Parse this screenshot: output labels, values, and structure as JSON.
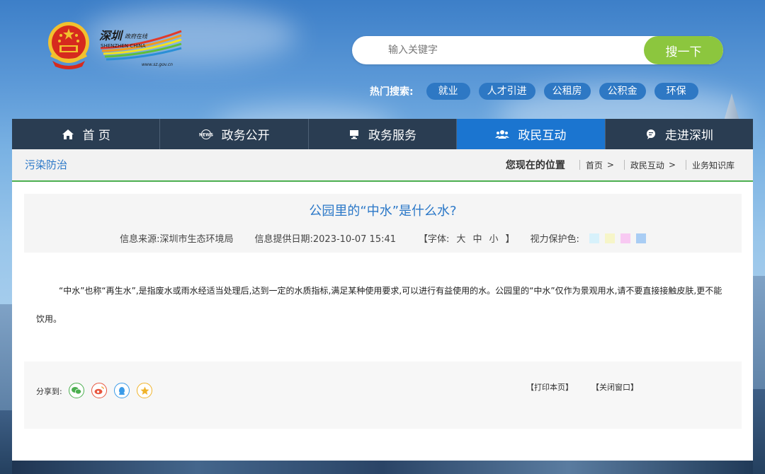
{
  "header": {
    "logo_text": "深圳政府在线",
    "logo_sub": "SHENZHEN CHINA",
    "logo_url": "www.sz.gov.cn"
  },
  "search": {
    "placeholder": "输入关键字",
    "button_label": "搜一下"
  },
  "hot_search": {
    "label": "热门搜索:",
    "tags": [
      "就业",
      "人才引进",
      "公租房",
      "公积金",
      "环保"
    ]
  },
  "nav": {
    "items": [
      {
        "label": "首 页",
        "icon": "home-icon"
      },
      {
        "label": "政务公开",
        "icon": "news-icon"
      },
      {
        "label": "政务服务",
        "icon": "monitor-icon"
      },
      {
        "label": "政民互动",
        "icon": "users-icon",
        "active": true
      },
      {
        "label": "走进深圳",
        "icon": "chat-icon"
      }
    ]
  },
  "breadcrumb": {
    "section": "污染防治",
    "location_label": "您现在的位置",
    "path": [
      "首页",
      "政民互动",
      "业务知识库"
    ]
  },
  "article": {
    "title": "公园里的“中水”是什么水?",
    "source": "信息来源:深圳市生态环境局",
    "date": "信息提供日期:2023-10-07 15:41",
    "font_label": "【字体:",
    "font_sizes": [
      "大",
      "中",
      "小"
    ],
    "font_close": "】",
    "eye_label": "视力保护色:",
    "eye_colors": [
      "#d7f1fb",
      "#f6f5c8",
      "#f8c9f2",
      "#a9cdf4"
    ],
    "body": "“中水”也称“再生水”,是指废水或雨水经适当处理后,达到一定的水质指标,满足某种使用要求,可以进行有益使用的水。公园里的“中水”仅作为景观用水,请不要直接接触皮肤,更不能饮用。"
  },
  "share": {
    "label": "分享到:",
    "icons": [
      "wechat-icon",
      "weibo-icon",
      "qq-icon",
      "qzone-icon"
    ],
    "print_label": "【打印本页】",
    "close_label": "【关闭窗口】"
  }
}
